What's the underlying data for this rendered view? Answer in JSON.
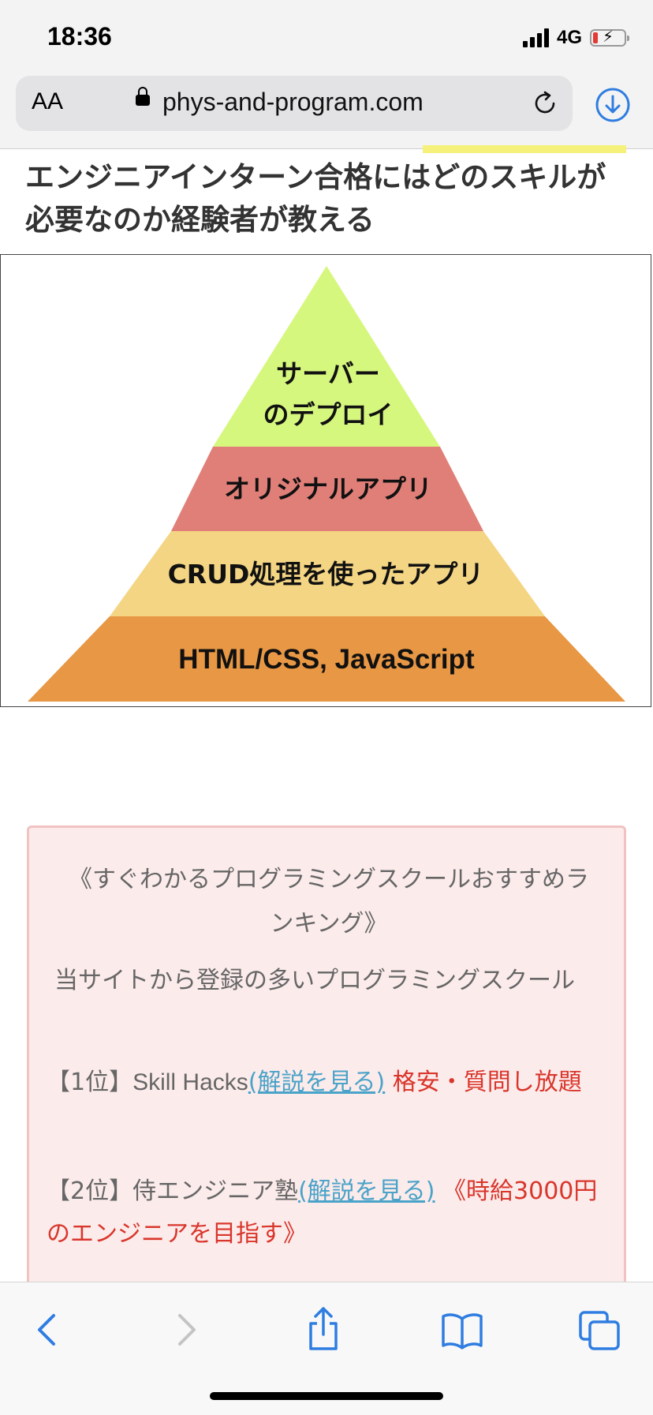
{
  "status_bar": {
    "time": "18:36",
    "network": "4G",
    "battery_level": 0.15,
    "battery_color": "#e53935"
  },
  "browser": {
    "text_size_label": "AA",
    "url": "phys-and-program.com",
    "icons": [
      "lock-icon",
      "reload-icon",
      "download-icon"
    ]
  },
  "article": {
    "title": "エンジニアインターン合格にはどのスキルが必要なのか経験者が教える"
  },
  "pyramid": {
    "levels": [
      {
        "label_line1": "サーバー",
        "label_line2": "のデプロイ",
        "color": "#d6f77e"
      },
      {
        "label": "オリジナルアプリ",
        "color": "#e07f78"
      },
      {
        "label": "CRUD処理を使ったアプリ",
        "color": "#f4d584"
      },
      {
        "label": "HTML/CSS, JavaScript",
        "color": "#e89744"
      }
    ]
  },
  "recommendation": {
    "heading": "《すぐわかるプログラミングスクールおすすめランキング》",
    "intro": "当サイトから登録の多いプログラミングスクール",
    "items": [
      {
        "rank": "【1位】",
        "name": "Skill Hacks",
        "link": "(解説を見る)",
        "tagline": " 格安・質問し放題"
      },
      {
        "rank": "【2位】",
        "name": "侍エンジニア塾",
        "link": "(解説を見る)",
        "tagline": " 《時給3000円のエンジニアを目指す》"
      }
    ],
    "colors": {
      "background": "#fcebeb",
      "link": "#4aa3c8",
      "accent": "#d9362b"
    }
  },
  "toolbar": {
    "items": [
      "back-icon",
      "forward-icon",
      "share-icon",
      "bookmarks-icon",
      "tabs-icon"
    ],
    "accent": "#2f7de1"
  }
}
